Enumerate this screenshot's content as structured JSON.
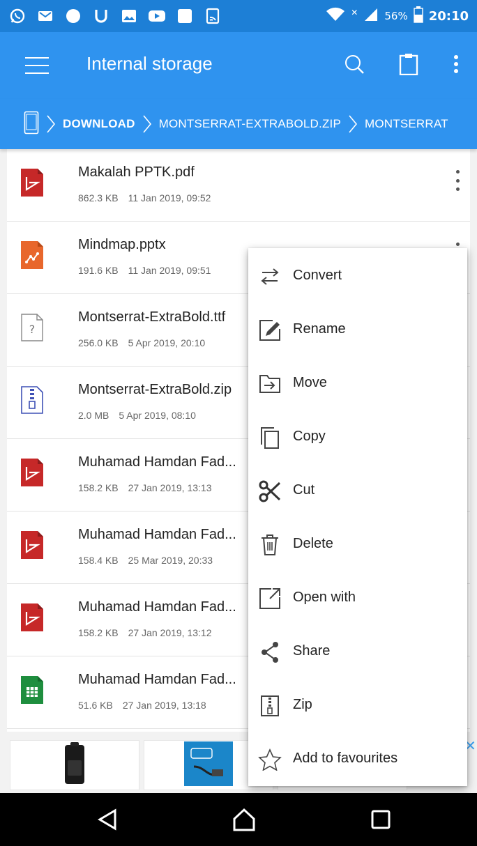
{
  "status_bar": {
    "left_icons": [
      "whatsapp-icon",
      "gmail-icon",
      "circle-app-icon",
      "u-app-icon",
      "gallery-icon",
      "youtube-icon",
      "square-app-icon",
      "cast-icon"
    ],
    "battery": "56%",
    "time": "20:10"
  },
  "app_bar": {
    "title": "Internal storage"
  },
  "breadcrumb": {
    "items": [
      "DOWNLOAD",
      "MONTSERRAT-EXTRABOLD.ZIP",
      "MONTSERRAT"
    ]
  },
  "files": [
    {
      "name": "Makalah PPTK.pdf",
      "size": "862.3 KB",
      "date": "11 Jan 2019, 09:52",
      "icon": "pdf-icon"
    },
    {
      "name": "Mindmap.pptx",
      "size": "191.6 KB",
      "date": "11 Jan 2019, 09:51",
      "icon": "pptx-icon"
    },
    {
      "name": "Montserrat-ExtraBold.ttf",
      "size": "256.0 KB",
      "date": "5 Apr 2019, 20:10",
      "icon": "unknown-file-icon"
    },
    {
      "name": "Montserrat-ExtraBold.zip",
      "size": "2.0 MB",
      "date": "5 Apr 2019, 08:10",
      "icon": "zip-file-icon"
    },
    {
      "name": "Muhamad Hamdan Fad...",
      "size": "158.2 KB",
      "date": "27 Jan 2019, 13:13",
      "icon": "pdf-icon"
    },
    {
      "name": "Muhamad Hamdan Fad...",
      "size": "158.4 KB",
      "date": "25 Mar 2019, 20:33",
      "icon": "pdf-icon"
    },
    {
      "name": "Muhamad Hamdan Fad...",
      "size": "158.2 KB",
      "date": "27 Jan 2019, 13:12",
      "icon": "pdf-icon"
    },
    {
      "name": "Muhamad Hamdan Fad...",
      "size": "51.6 KB",
      "date": "27 Jan 2019, 13:18",
      "icon": "sheet-icon"
    }
  ],
  "context_menu": {
    "items": [
      {
        "label": "Convert",
        "icon": "convert-icon"
      },
      {
        "label": "Rename",
        "icon": "rename-icon"
      },
      {
        "label": "Move",
        "icon": "move-icon"
      },
      {
        "label": "Copy",
        "icon": "copy-icon"
      },
      {
        "label": "Cut",
        "icon": "cut-icon"
      },
      {
        "label": "Delete",
        "icon": "delete-icon"
      },
      {
        "label": "Open with",
        "icon": "open-with-icon"
      },
      {
        "label": "Share",
        "icon": "share-icon"
      },
      {
        "label": "Zip",
        "icon": "zip-icon"
      },
      {
        "label": "Add to favourites",
        "icon": "star-icon"
      }
    ]
  },
  "colors": {
    "status_bar": "#1d7fd6",
    "app_bar": "#2f93ef",
    "pdf": "#c62828",
    "pptx": "#e8672c",
    "sheet": "#1e8e3e",
    "zip": "#3f51b5"
  }
}
